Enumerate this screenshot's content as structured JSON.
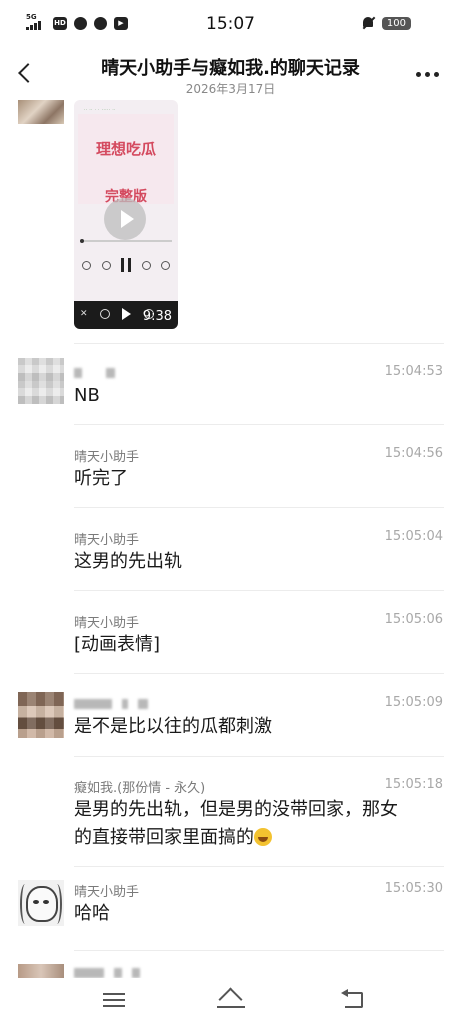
{
  "status_bar": {
    "network": "5G",
    "icons": [
      "signal-icon",
      "hd-icon",
      "wechat-icon",
      "app-icon",
      "media-icon"
    ],
    "time": "15:07",
    "battery": "100"
  },
  "header": {
    "title": "晴天小助手与癡如我.的聊天记录",
    "date": "2026年3月17日"
  },
  "video": {
    "title_line1": "理想吃瓜",
    "title_line2": "完整版",
    "duration": "9:38"
  },
  "messages": [
    {
      "sender": "",
      "time": "15:04:53",
      "text": "NB"
    },
    {
      "sender": "晴天小助手",
      "time": "15:04:56",
      "text": "听完了"
    },
    {
      "sender": "晴天小助手",
      "time": "15:05:04",
      "text": "这男的先出轨"
    },
    {
      "sender": "晴天小助手",
      "time": "15:05:06",
      "text": "[动画表情]"
    },
    {
      "sender": "",
      "time": "15:05:09",
      "text": "是不是比以往的瓜都刺激"
    },
    {
      "sender": "癡如我.(那份情 - 永久)",
      "time": "15:05:18",
      "text_line1": "是男的先出轨，但是男的没带回家，那女",
      "text_line2": "的直接带回家里面搞的"
    },
    {
      "sender": "晴天小助手",
      "time": "15:05:30",
      "text": "哈哈"
    }
  ]
}
